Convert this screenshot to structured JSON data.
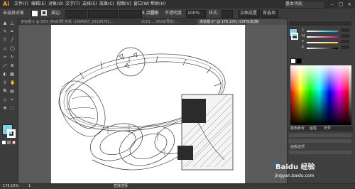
{
  "app": {
    "logo": "Ai"
  },
  "menubar": {
    "items": [
      "文件(F)",
      "编辑(E)",
      "对象(O)",
      "文字(T)",
      "选择(S)",
      "效果(C)",
      "视图(V)",
      "窗口(W)",
      "帮助(H)"
    ],
    "workspace": "基本功能",
    "window_controls": [
      "–",
      "□",
      "×"
    ]
  },
  "controlbar": {
    "selection_label": "未选择对象",
    "stroke_label": "描边:",
    "style_label": "5 点圆形",
    "opacity_label": "不透明度",
    "opacity_value": "100%",
    "style2_label": "样式:",
    "doc_setup_label": "文档设置",
    "prefs_label": "首选项"
  },
  "tabs": [
    {
      "label": "未标题-1 @ 50% (RGB/预览)",
      "active": false
    },
    {
      "label": "形状 -1664067_20190701...",
      "active": false
    },
    {
      "label": "2021 ... (RGB/预览) ...",
      "active": false
    },
    {
      "label": "未标题-2* @ 176.15% (CMYK/轮廓)",
      "active": true
    }
  ],
  "colors": {
    "fill": "#7fd1e0",
    "stroke": "#ffffff",
    "accent": "#d13b3b"
  },
  "panel": {
    "color_sliders": [
      "C",
      "M",
      "Y",
      "K"
    ],
    "tabs": [
      "颜色参考",
      "画笔",
      "符号"
    ],
    "section_label": "画板选项"
  },
  "status": {
    "zoom": "176.15%",
    "page": "1",
    "mode": "直接选择"
  },
  "watermark": {
    "brand": "Baidu 经验",
    "url": "jingyan.baidu.com"
  }
}
